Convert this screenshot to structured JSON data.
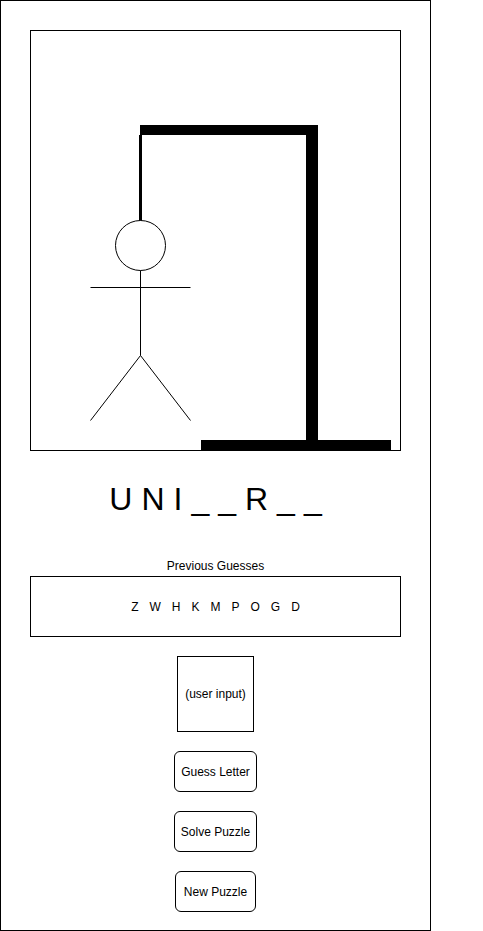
{
  "canvas": {
    "figure": {
      "head": true,
      "body": true,
      "arms": true,
      "legs": true
    }
  },
  "word": {
    "letters": [
      "U",
      "N",
      "I",
      "_",
      "_",
      "R",
      "_",
      "_"
    ]
  },
  "previous_guesses": {
    "label": "Previous Guesses",
    "letters": [
      "Z",
      "W",
      "H",
      "K",
      "M",
      "P",
      "O",
      "G",
      "D"
    ]
  },
  "input": {
    "placeholder": "(user input)"
  },
  "buttons": [
    "Guess Letter",
    "Solve Puzzle",
    "New Puzzle"
  ]
}
